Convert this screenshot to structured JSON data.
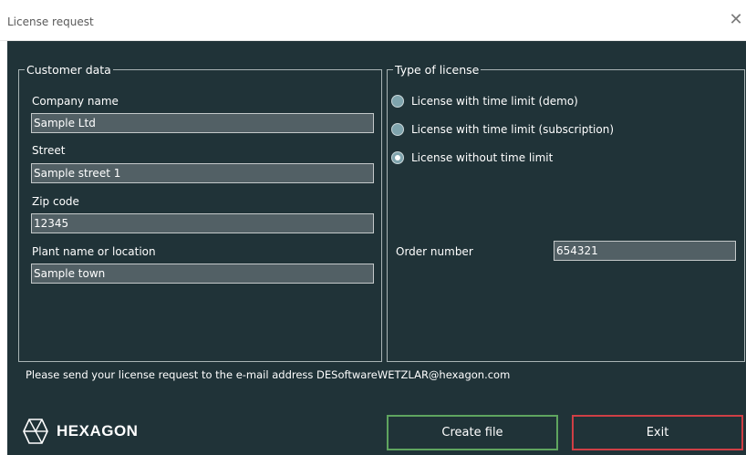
{
  "window": {
    "title": "License request",
    "close_icon": "close-icon",
    "close_glyph": "✕"
  },
  "customer": {
    "legend": "Customer data",
    "company_label": "Company name",
    "company_value": "Sample Ltd",
    "street_label": "Street",
    "street_value": "Sample street 1",
    "zip_label": "Zip code",
    "zip_value": "12345",
    "plant_label": "Plant name or location",
    "plant_value": "Sample town"
  },
  "license": {
    "legend": "Type of license",
    "options": [
      {
        "label": "License with time limit (demo)",
        "selected": false
      },
      {
        "label": "License with time limit (subscription)",
        "selected": false
      },
      {
        "label": "License without time limit",
        "selected": true
      }
    ],
    "order_label": "Order number",
    "order_value": "654321"
  },
  "footer": {
    "note": "Please send your license request to the e-mail address DESoftwareWETZLAR@hexagon.com",
    "logo_text": "HEXAGON",
    "create_label": "Create file",
    "exit_label": "Exit"
  },
  "colors": {
    "background": "#203338",
    "field": "#526065",
    "create_border": "#5fa55f",
    "exit_border": "#cf3f45"
  }
}
